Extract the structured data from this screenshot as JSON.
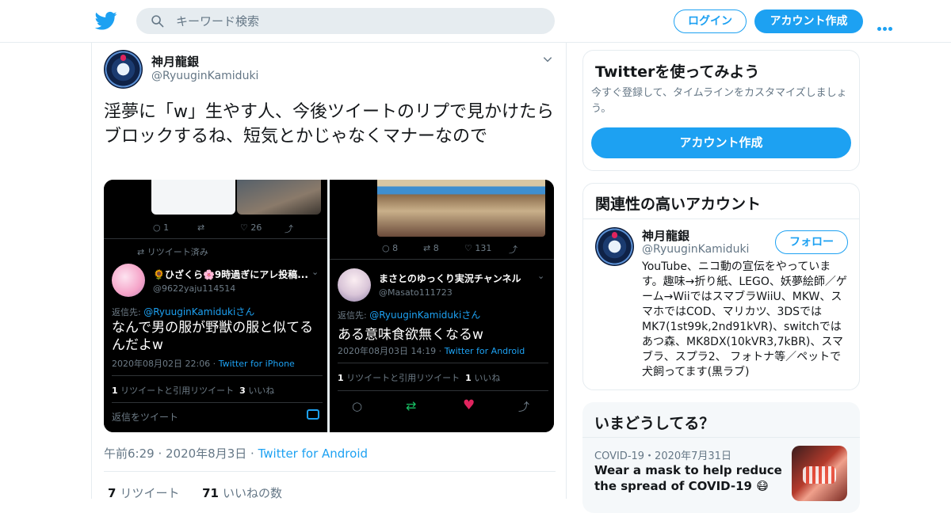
{
  "header": {
    "search_placeholder": "キーワード検索",
    "login_label": "ログイン",
    "signup_label": "アカウント作成",
    "brand_color": "#1da1f2"
  },
  "tweet": {
    "author_name": "神月龍銀",
    "author_handle": "@RyuuginKamiduki",
    "text": "淫夢に「w」生やす人、今後ツイートのリプで見かけたらブロックするね、短気とかじゃなくマナーなので",
    "time": "午前6:29",
    "date": "2020年8月3日",
    "source": "Twitter for Android",
    "retweet_count": "7",
    "retweet_label": "リツイート",
    "like_count": "71",
    "like_label": "いいねの数",
    "media": {
      "left": {
        "top_stats": [
          "1",
          "26"
        ],
        "retweeted_label": "リツイート済み",
        "reply_name": "🌻ひざくら🌸9時過ぎにアレ投稿...",
        "reply_handle": "@9622yaju114514",
        "reply_to_prefix": "返信先: ",
        "reply_to_handle": "@RyuuginKamidukiさん",
        "reply_text": "なんで男の服が野獣の服と似てるんだよw",
        "reply_time": "2020年08月02日 22:06 · ",
        "reply_source": "Twitter for iPhone",
        "rt_count": "1",
        "rt_label": "リツイートと引用リツイート",
        "like_count": "3",
        "like_label": "いいね",
        "reply_prompt": "返信をツイート"
      },
      "right": {
        "top_stats": [
          "8",
          "8",
          "131"
        ],
        "reply_name": "まさとのゆっくり実況チャンネル",
        "reply_handle": "@Masato111723",
        "reply_to_prefix": "返信先: ",
        "reply_to_handle": "@RyuuginKamidukiさん",
        "reply_text": "ある意味食欲無くなるw",
        "reply_time": "2020年08月03日 14:19 · ",
        "reply_source": "Twitter for Android",
        "rt_count": "1",
        "rt_label": "リツイートと引用リツイート",
        "like_count": "1",
        "like_label": "いいね"
      }
    }
  },
  "sidebar": {
    "signup_card": {
      "title": "Twitterを使ってみよう",
      "desc": "今すぐ登録して、タイムラインをカスタマイズしましょう。",
      "button": "アカウント作成"
    },
    "related_card": {
      "title": "関連性の高いアカウント",
      "name": "神月龍銀",
      "handle": "@RyuuginKamiduki",
      "follow_label": "フォロー",
      "bio": "YouTube、ニコ動の宣伝をやっています。趣味→折り紙、LEGO、妖夢絵師／ゲーム→WiiではスマブラWiiU、MKW、スマホではCOD、マリカツ、3DSではMK7(1st99k,2nd91kVR)、switchではあつ森、MK8DX(10kVR3,7kBR)、スマブラ、スプラ2、 フォトナ等／ペットで犬飼ってます(黒ラブ)"
    },
    "trends_card": {
      "title": "いまどうしてる？",
      "meta": "COVID-19・2020年7月31日",
      "headline": "Wear a mask to help reduce the spread of COVID-19 😷"
    }
  }
}
